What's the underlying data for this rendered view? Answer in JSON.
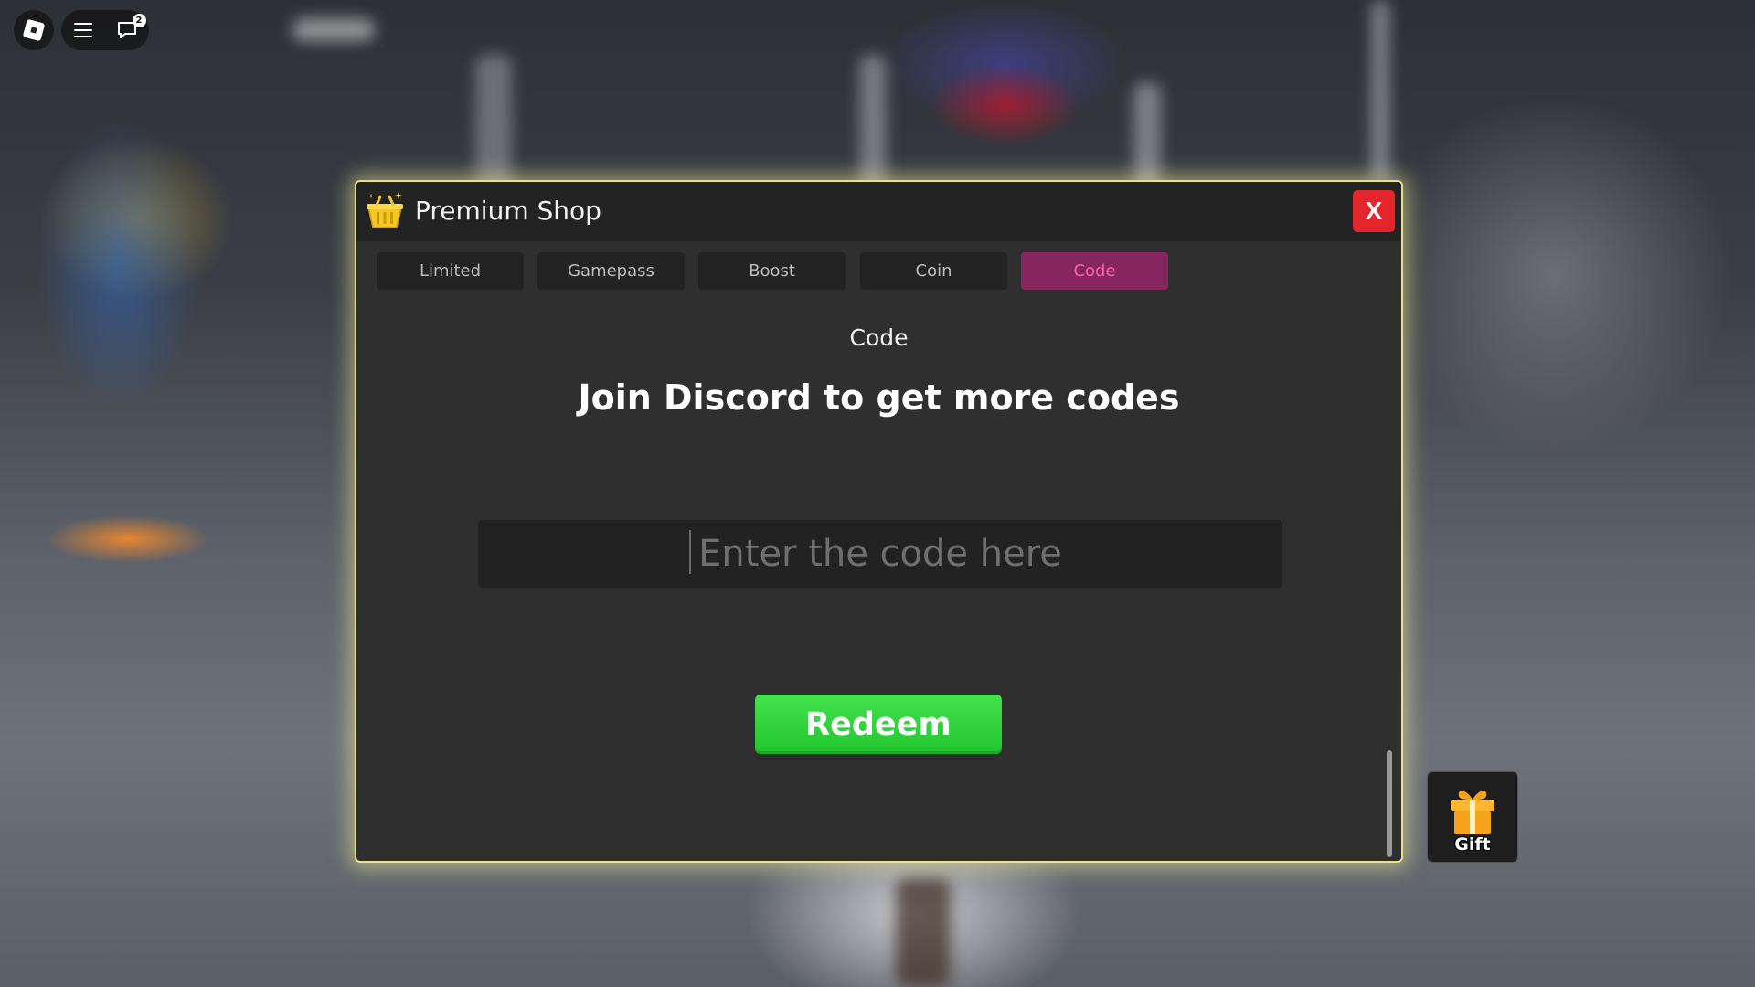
{
  "topbar": {
    "roblox_icon": "roblox-logo-icon",
    "menu_icon": "hamburger-menu-icon",
    "chat_icon": "chat-icon",
    "chat_badge_count": "2"
  },
  "shop": {
    "title": "Premium Shop",
    "icon": "shop-basket-icon",
    "close_label": "X",
    "tabs": [
      {
        "label": "Limited",
        "active": false
      },
      {
        "label": "Gamepass",
        "active": false
      },
      {
        "label": "Boost",
        "active": false
      },
      {
        "label": "Coin",
        "active": false
      },
      {
        "label": "Code",
        "active": true
      }
    ],
    "section_title": "Code",
    "headline": "Join Discord to get more codes",
    "code_input": {
      "value": "",
      "placeholder": "Enter the code here"
    },
    "redeem_label": "Redeem",
    "colors": {
      "border": "#e6e28a",
      "close": "#e4262c",
      "active_tab_bg": "#86265f",
      "active_tab_text": "#ff5fb0",
      "redeem": "#2fd13b"
    }
  },
  "gift": {
    "label": "Gift",
    "icon": "gift-box-icon"
  }
}
